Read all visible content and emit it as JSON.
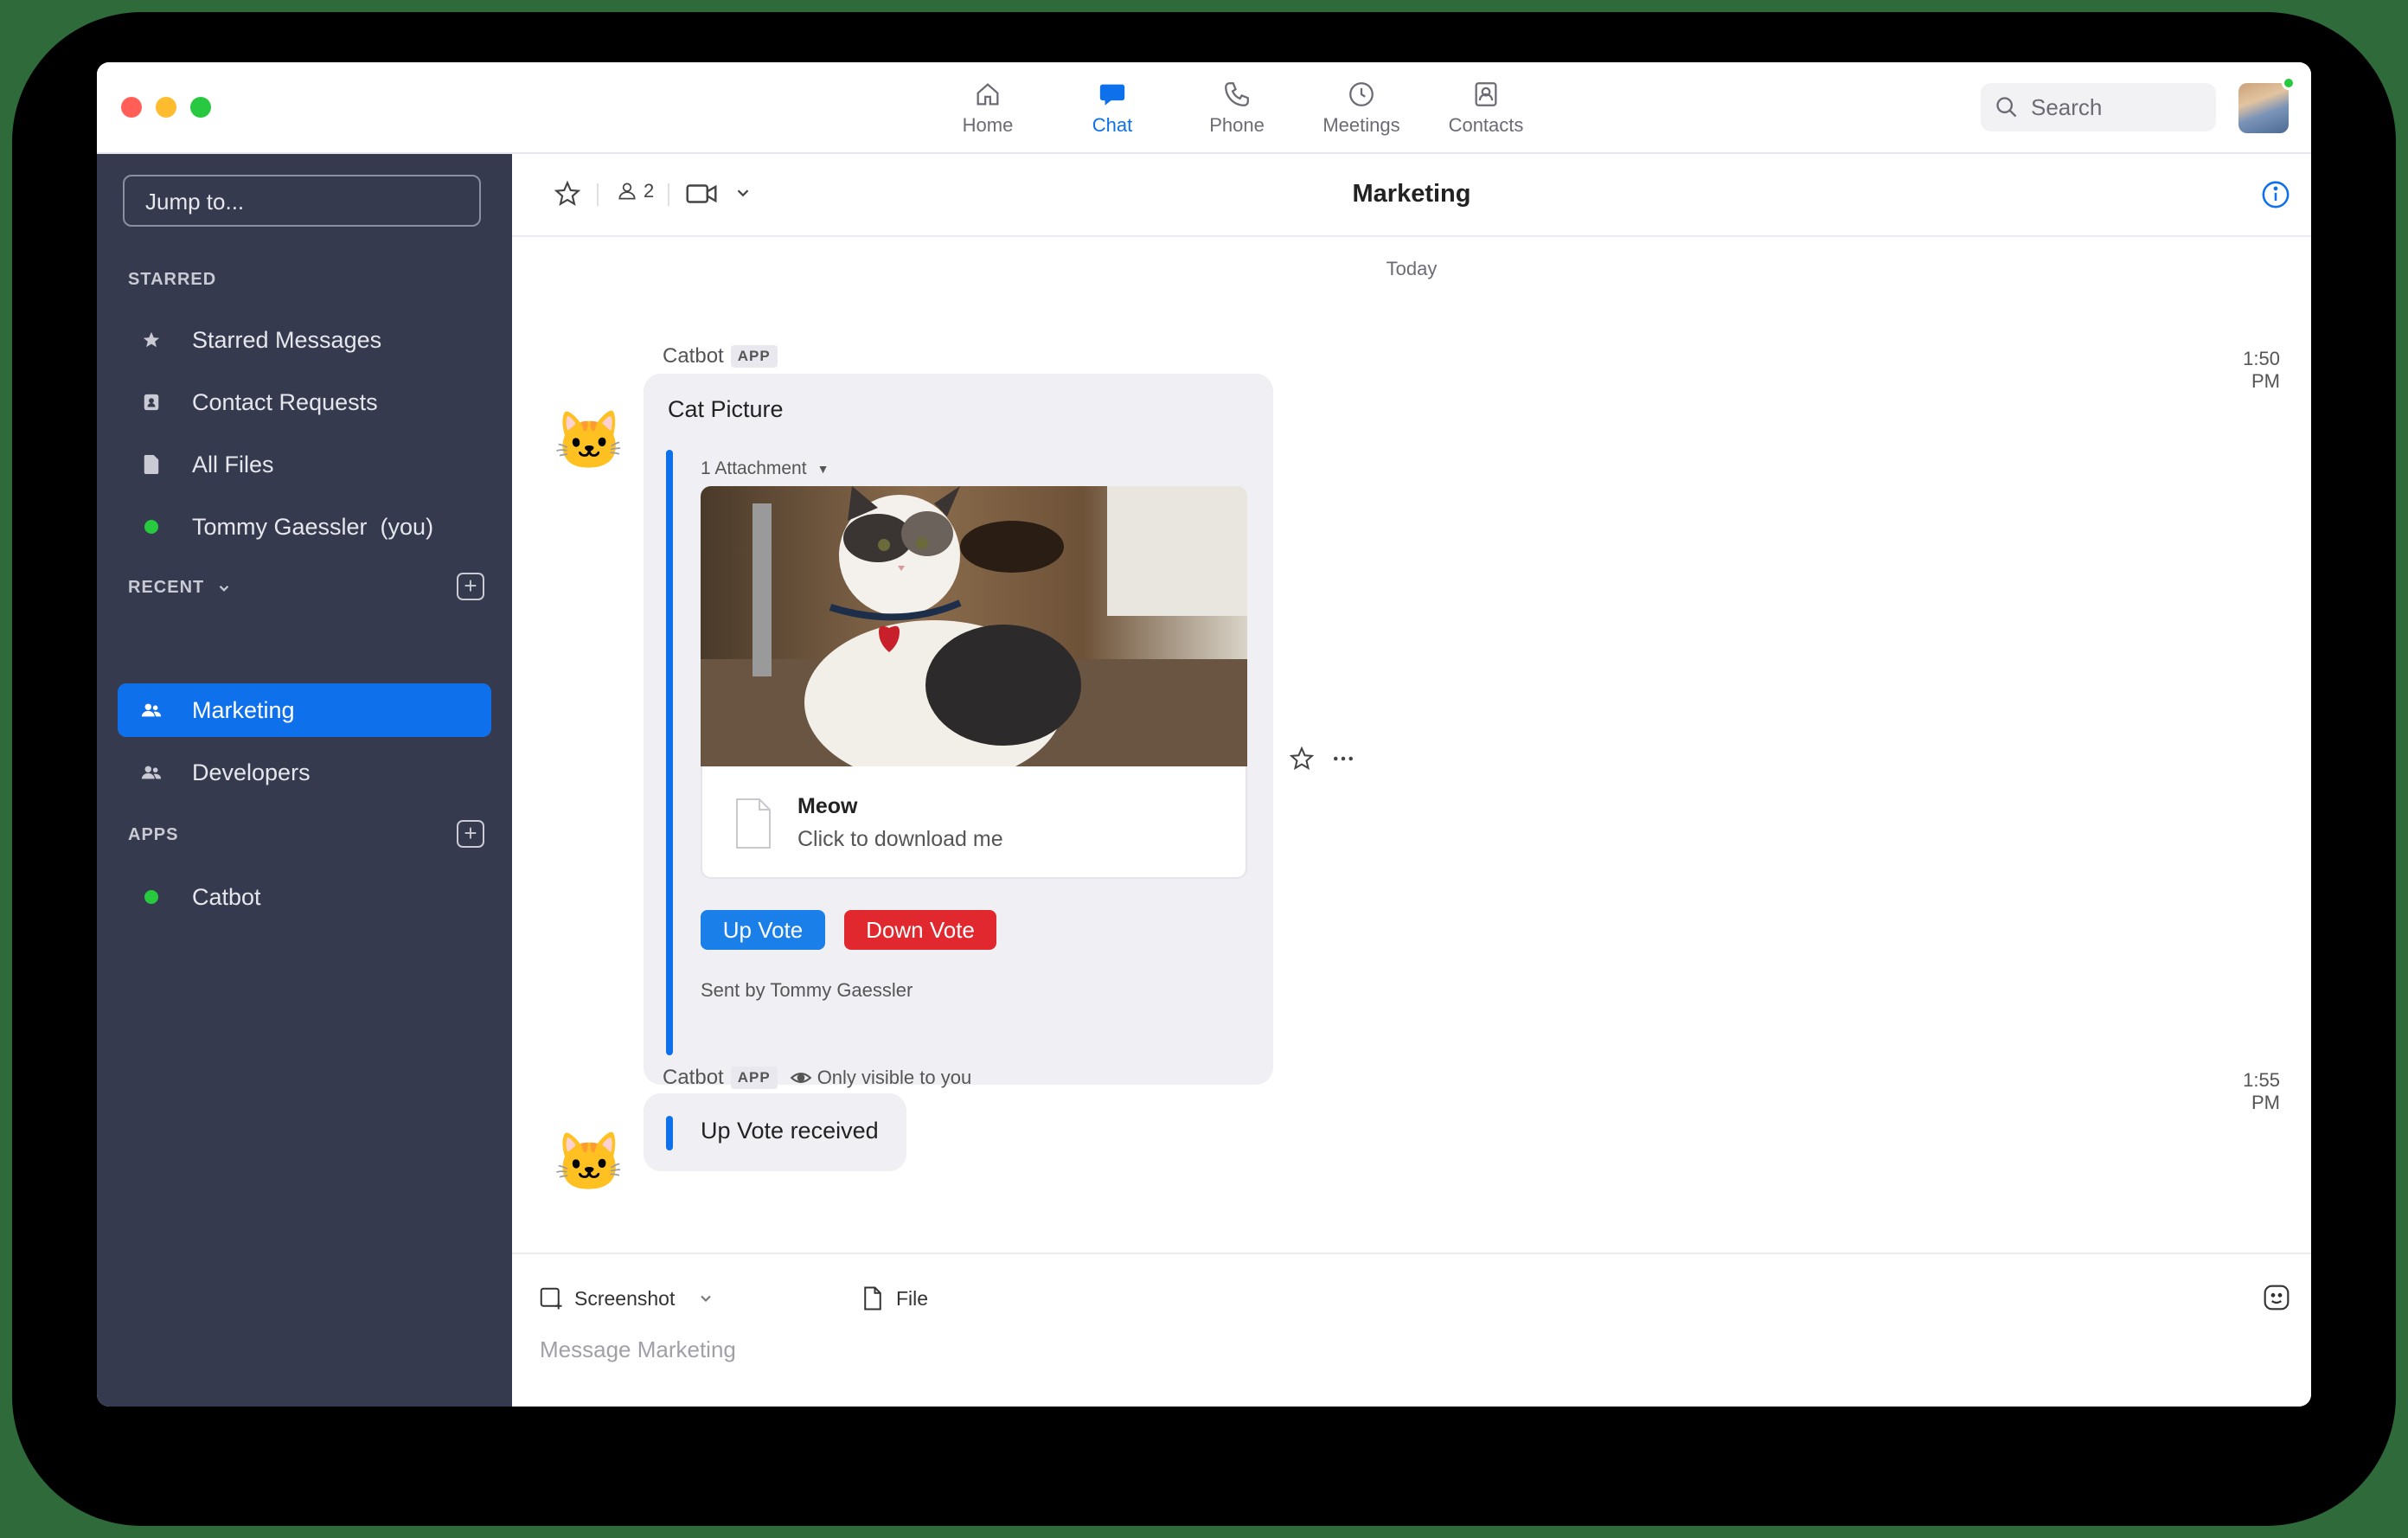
{
  "nav": {
    "items": [
      {
        "label": "Home",
        "icon": "home-icon",
        "active": false
      },
      {
        "label": "Chat",
        "icon": "chat-icon",
        "active": true
      },
      {
        "label": "Phone",
        "icon": "phone-icon",
        "active": false
      },
      {
        "label": "Meetings",
        "icon": "clock-icon",
        "active": false
      },
      {
        "label": "Contacts",
        "icon": "contacts-icon",
        "active": false
      }
    ],
    "search_placeholder": "Search"
  },
  "sidebar": {
    "jump_placeholder": "Jump to...",
    "starred_header": "STARRED",
    "starred": [
      {
        "label": "Starred Messages",
        "icon": "star-icon"
      },
      {
        "label": "Contact Requests",
        "icon": "contact-card-icon"
      },
      {
        "label": "All Files",
        "icon": "file-icon"
      },
      {
        "label": "Tommy Gaessler  (you)",
        "icon": "online-dot-icon"
      }
    ],
    "recent_header": "RECENT",
    "recent": [
      {
        "label": "Marketing",
        "icon": "group-icon",
        "active": true
      },
      {
        "label": "Developers",
        "icon": "group-icon",
        "active": false
      }
    ],
    "apps_header": "APPS",
    "apps": [
      {
        "label": "Catbot",
        "icon": "online-dot-icon"
      }
    ]
  },
  "chat": {
    "title": "Marketing",
    "member_count": "2",
    "day_label": "Today",
    "messages": [
      {
        "sender": "Catbot",
        "badge": "APP",
        "time": "1:50 PM",
        "title": "Cat Picture",
        "attachment_label": "1 Attachment",
        "file_name": "Meow",
        "file_sub": "Click to download me",
        "up_vote": "Up Vote",
        "down_vote": "Down Vote",
        "sent_by": "Sent by Tommy Gaessler"
      },
      {
        "sender": "Catbot",
        "badge": "APP",
        "visibility": "Only visible to you",
        "time": "1:55 PM",
        "text": "Up Vote received"
      }
    ]
  },
  "composer": {
    "screenshot_label": "Screenshot",
    "file_label": "File",
    "placeholder": "Message Marketing"
  },
  "colors": {
    "accent": "#0e71eb",
    "sidebar_bg": "#363a4f",
    "up_vote": "#1a7fe8",
    "down_vote": "#e0282e",
    "online": "#27c93f"
  }
}
